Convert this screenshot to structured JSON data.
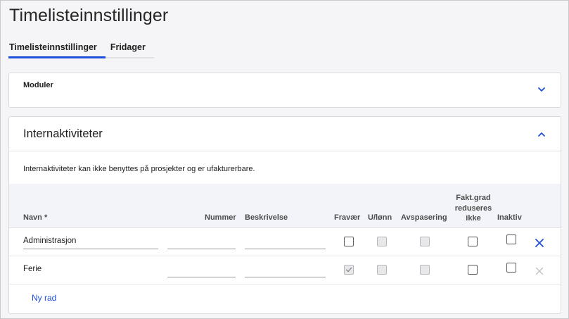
{
  "page": {
    "title": "Timelisteinnstillinger"
  },
  "tabs": [
    {
      "label": "Timelisteinnstillinger",
      "active": true
    },
    {
      "label": "Fridager",
      "active": false
    }
  ],
  "modules": {
    "title": "Moduler",
    "icon": "chevron-down-icon"
  },
  "internal": {
    "title": "Internaktiviteter",
    "icon": "chevron-up-icon",
    "intro": "Internaktiviteter kan ikke benyttes på prosjekter og er ufakturerbare.",
    "columns": {
      "name": "Navn *",
      "number": "Nummer",
      "description": "Beskrivelse",
      "absence": "Fravær",
      "unpaid": "U/lønn",
      "time_off": "Avspasering",
      "billing_rate_line1": "Fakt.grad",
      "billing_rate_line2": "reduseres",
      "billing_rate_line3": "ikke",
      "inactive": "Inaktiv"
    },
    "rows": [
      {
        "name": "Administrasjon",
        "number": "",
        "description": "",
        "absence": false,
        "unpaid": false,
        "time_off": false,
        "billing_rate_not_reduced": false,
        "inactive": false,
        "delete_enabled": true
      },
      {
        "name": "Ferie",
        "number": "",
        "description": "",
        "absence": true,
        "unpaid": false,
        "time_off": false,
        "billing_rate_not_reduced": false,
        "inactive": false,
        "delete_enabled": false
      }
    ],
    "add_row_label": "Ny rad"
  },
  "colors": {
    "accent": "#1f4fd8",
    "header_bg": "#f2f4f9",
    "disabled_icon": "#c4c4c8"
  }
}
